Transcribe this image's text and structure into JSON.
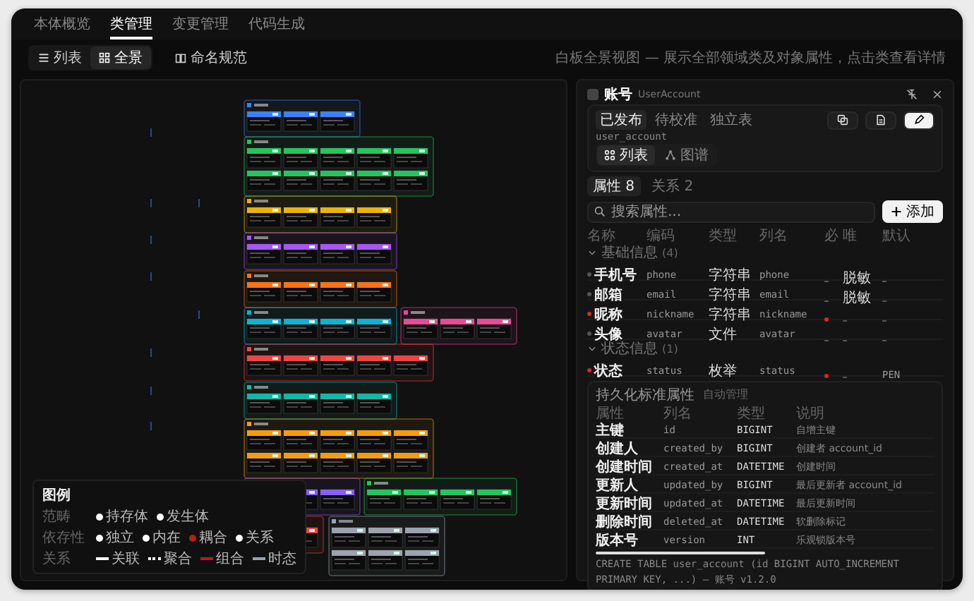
{
  "tabs": [
    {
      "label": "本体概览",
      "selected": false
    },
    {
      "label": "类管理",
      "selected": true
    },
    {
      "label": "变更管理",
      "selected": false
    },
    {
      "label": "代码生成",
      "selected": false
    }
  ],
  "toolbar": {
    "views": [
      {
        "label": "列表",
        "kind": "list",
        "selected": false
      },
      {
        "label": "全景",
        "kind": "grid",
        "selected": true
      }
    ],
    "naming_button": "命名规范",
    "hint": "白板全景视图 — 展示全部领域类及对象属性，点击类查看详情"
  },
  "legend": {
    "title": "图例",
    "rows": [
      {
        "label": "范畴",
        "items": [
          {
            "label": "持存体",
            "color": "#ffffff",
            "kind": "dot"
          },
          {
            "label": "发生体",
            "color": "#ffffff",
            "kind": "dot"
          }
        ]
      },
      {
        "label": "依存性",
        "items": [
          {
            "label": "独立",
            "color": "#ffffff",
            "kind": "dot"
          },
          {
            "label": "内在",
            "color": "#ffffff",
            "kind": "dot"
          },
          {
            "label": "耦合",
            "color": "#b91c1c",
            "kind": "dot"
          },
          {
            "label": "关系",
            "color": "#ffffff",
            "kind": "dot"
          }
        ]
      },
      {
        "label": "关系",
        "items": [
          {
            "label": "关联",
            "color": "#ffffff",
            "kind": "solid"
          },
          {
            "label": "聚合",
            "color": "#ffffff",
            "kind": "dotted"
          },
          {
            "label": "组合",
            "color": "#b91c1c",
            "kind": "solid"
          },
          {
            "label": "时态",
            "color": "#9ca3af",
            "kind": "solid"
          }
        ]
      }
    ]
  },
  "detail": {
    "title": "账号",
    "subtitle": "UserAccount",
    "status_chips": [
      {
        "label": "已发布",
        "selected": true
      },
      {
        "label": "待校准",
        "selected": false
      },
      {
        "label": "独立表",
        "selected": false
      }
    ],
    "table_name": "user_account",
    "actions": [
      {
        "kind": "copy",
        "selected": false
      },
      {
        "kind": "document",
        "selected": false
      },
      {
        "kind": "edit",
        "selected": true
      }
    ],
    "view_toggle": [
      {
        "label": "列表",
        "kind": "grid",
        "selected": true
      },
      {
        "label": "图谱",
        "kind": "graph",
        "selected": false
      }
    ],
    "sub_tabs": [
      {
        "label": "属性 8",
        "selected": true
      },
      {
        "label": "关系 2",
        "selected": false
      }
    ],
    "search": {
      "placeholder": "搜索属性..."
    },
    "add_button": "添加",
    "columns": [
      "名称",
      "编码",
      "类型",
      "列名",
      "必",
      "唯",
      "默认"
    ],
    "groups": [
      {
        "title": "基础信息",
        "count": "(4)",
        "expanded": true,
        "rows": [
          {
            "name": "手机号",
            "code": "phone",
            "type": "字符串",
            "column": "phone",
            "required": false,
            "unique": "脱敏"
          },
          {
            "name": "邮箱",
            "code": "email",
            "type": "字符串",
            "column": "email",
            "required": false,
            "unique": "脱敏"
          },
          {
            "name": "昵称",
            "code": "nickname",
            "type": "字符串",
            "column": "nickname",
            "required": true
          },
          {
            "name": "头像",
            "code": "avatar",
            "type": "文件",
            "column": "avatar",
            "required": false
          }
        ]
      },
      {
        "title": "状态信息",
        "count": "(1)",
        "expanded": true,
        "rows": [
          {
            "name": "状态",
            "code": "status",
            "type": "枚举",
            "column": "status",
            "required": true,
            "default": "PEN"
          }
        ]
      }
    ],
    "standard": {
      "title": "持久化标准属性",
      "note": "自动管理",
      "columns": [
        "属性",
        "列名",
        "类型",
        "说明"
      ],
      "rows": [
        [
          "主键",
          "id",
          "BIGINT",
          "自增主键"
        ],
        [
          "创建人",
          "created_by",
          "BIGINT",
          "创建者 account_id"
        ],
        [
          "创建时间",
          "created_at",
          "DATETIME",
          "创建时间"
        ],
        [
          "更新人",
          "updated_by",
          "BIGINT",
          "最后更新者 account_id"
        ],
        [
          "更新时间",
          "updated_at",
          "DATETIME",
          "最后更新时间"
        ],
        [
          "删除时间",
          "deleted_at",
          "DATETIME",
          "软删除标记"
        ],
        [
          "版本号",
          "version",
          "INT",
          "乐观锁版本号"
        ]
      ]
    },
    "sql": [
      "CREATE TABLE user_account (id BIGINT AUTO_INCREMENT",
      "PRIMARY KEY, ...) — 账号 v1.2.0"
    ]
  }
}
